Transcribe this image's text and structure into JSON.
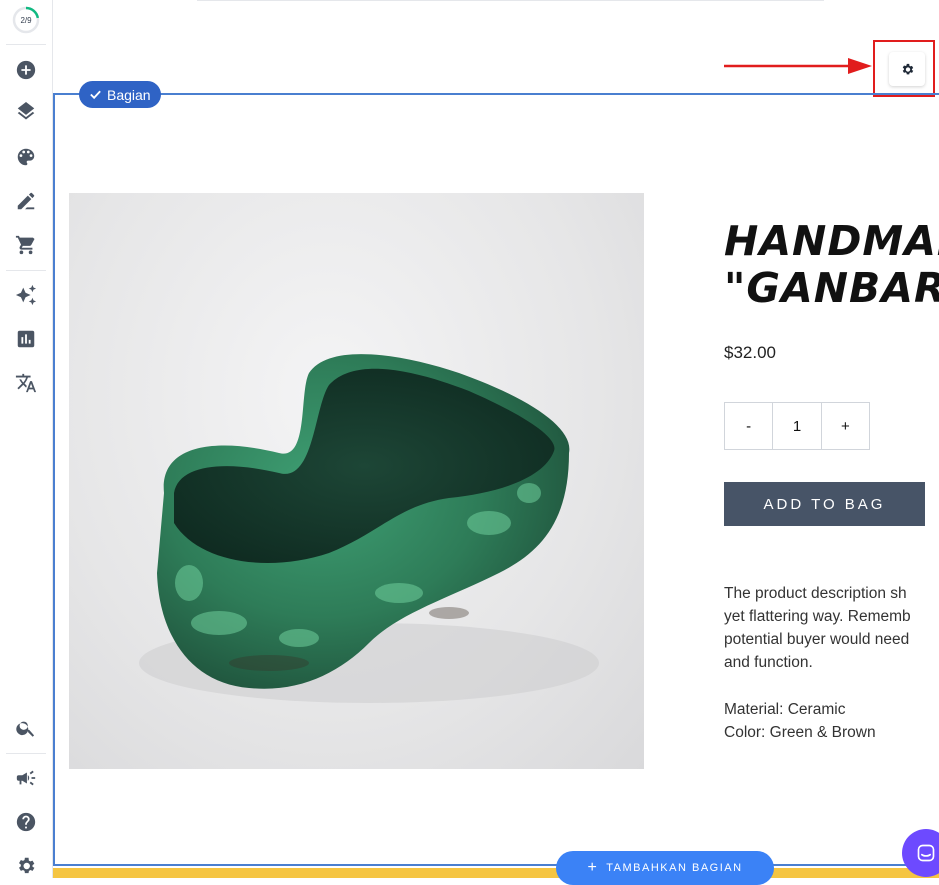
{
  "sidebar": {
    "progress": "2/9",
    "progress_fraction": 0.22,
    "items": [
      {
        "name": "add-icon"
      },
      {
        "name": "layers-icon"
      },
      {
        "name": "palette-icon"
      },
      {
        "name": "edit-icon"
      },
      {
        "name": "cart-icon"
      },
      {
        "name": "sparkle-icon"
      },
      {
        "name": "chart-icon"
      },
      {
        "name": "translate-icon"
      },
      {
        "name": "search-icon"
      },
      {
        "name": "megaphone-icon"
      },
      {
        "name": "help-icon"
      },
      {
        "name": "gear-icon"
      }
    ]
  },
  "section": {
    "badge_label": "Bagian",
    "add_section_label": "TAMBAHKAN BAGIAN"
  },
  "product": {
    "title": "HANDMADE\n\"GANBARU",
    "price": "$32.00",
    "qty_minus": "-",
    "qty_value": "1",
    "qty_plus": "+",
    "add_to_bag": "ADD TO BAG",
    "description_lines": [
      "The product description sh",
      "yet flattering way. Rememb",
      "potential buyer would need",
      "and function."
    ],
    "material": "Material: Ceramic",
    "color": "Color: Green & Brown"
  },
  "colors": {
    "accent_blue": "#2f63c5",
    "button_dark": "#475467",
    "highlight_red": "#e11d1d",
    "bottom_yellow": "#f5c542",
    "chat_purple": "#6d4aff"
  }
}
